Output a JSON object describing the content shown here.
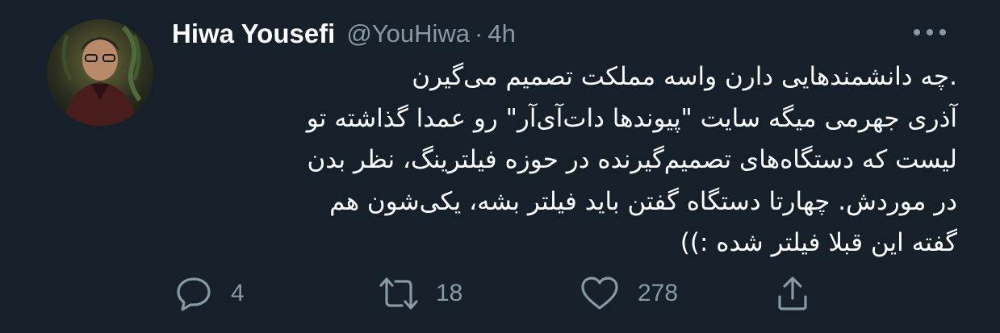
{
  "tweet": {
    "display_name": "Hiwa Yousefi",
    "handle": "@YouHiwa",
    "separator": "·",
    "timestamp": "4h",
    "text_lines": [
      ".چه دانشمندهایی دارن واسه مملکت تصمیم می‌گیرن",
      "آذری جهرمی میگه سایت \"پیوندها دات‌آی‌آر\" رو عمدا گذاشته تو",
      "لیست که دستگاه‌های تصمیم‌گیرنده در حوزه فیلترینگ، نظر بدن",
      "در موردش. چهارتا دستگاه گفتن باید فیلتر بشه، یکی‌شون هم",
      "گفته این قبلا فیلتر شده :))"
    ],
    "actions": {
      "reply_count": "4",
      "retweet_count": "18",
      "like_count": "278"
    }
  },
  "icons": {
    "more": "more-horizontal-icon",
    "reply": "reply-bubble-icon",
    "retweet": "retweet-icon",
    "like": "heart-icon",
    "share": "share-icon"
  },
  "colors": {
    "background": "#15202b",
    "text_primary": "#ffffff",
    "text_secondary": "#8899a6"
  }
}
